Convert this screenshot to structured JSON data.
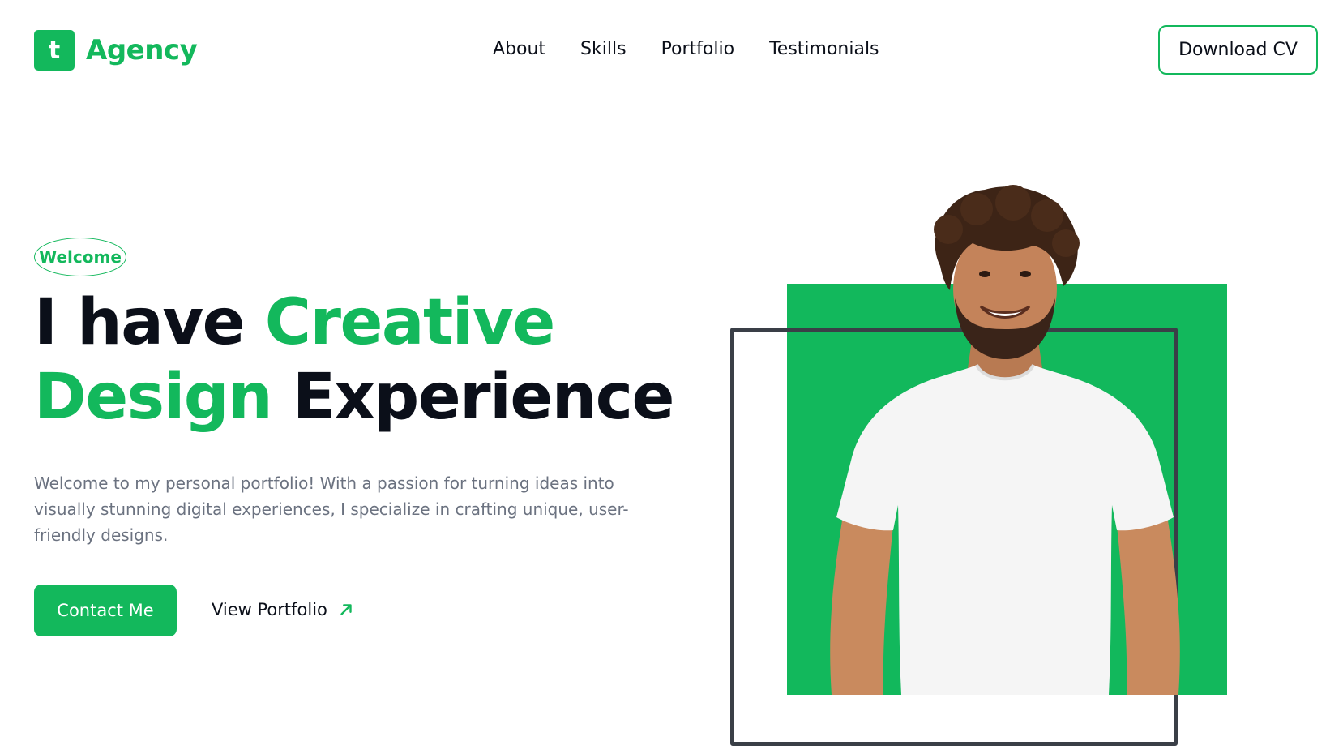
{
  "header": {
    "logo_letter": "t",
    "logo_text": "Agency",
    "nav": [
      "About",
      "Skills",
      "Portfolio",
      "Testimonials"
    ],
    "download_label": "Download CV"
  },
  "hero": {
    "badge": "Welcome",
    "headline": {
      "part1": "I have ",
      "part2": "Creative",
      "part3": "Design",
      "part4": " Experience"
    },
    "intro": "Welcome to my personal portfolio! With a passion for turning ideas into visually stunning digital experiences, I specialize in crafting unique, user-friendly designs.",
    "contact_label": "Contact Me",
    "portfolio_label": "View Portfolio"
  },
  "icons": {
    "arrow": "arrow-up-right-icon"
  },
  "colors": {
    "accent": "#13b85c",
    "text": "#0b0f19",
    "muted": "#6b7280",
    "frame": "#3a3f47"
  }
}
